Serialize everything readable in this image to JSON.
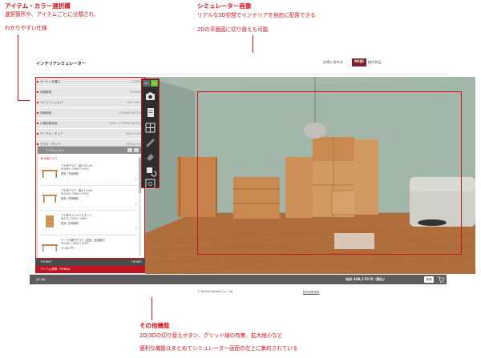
{
  "annotations": {
    "item_select": {
      "title": "アイテム・カラー選択欄",
      "lines": [
        "選択箇所や、アイテムごとに分類され、",
        "わかりやすい仕様"
      ]
    },
    "simulator": {
      "title": "シミュレーター画像",
      "lines": [
        "リアルな3D空間でインテリアを自由に配置できる",
        "2Dの平面図に切り替えも可能"
      ]
    },
    "other": {
      "title": "その他機能",
      "lines": [
        "2D/3Dの切り替えボタン、グリッド線の有無、拡大縮小など",
        "便利な機能はまとめてシミュレーター画面の左上に集約されている"
      ]
    }
  },
  "app": {
    "title": "インテリアシミュレーター",
    "contact": "お問い合わせ",
    "brand_logo": "MUJI",
    "brand_text": "無印良品"
  },
  "sidebar": {
    "categories": [
      {
        "label": "カーテンを選ぶ",
        "sub": "CURTAIN"
      },
      {
        "label": "収納家具",
        "sub": "STORAGE"
      },
      {
        "label": "ユニットシェルフ",
        "sub": "UNIT SHELF"
      },
      {
        "label": "収納用品",
        "sub": "STORING ARTICLE"
      },
      {
        "label": "小物収納用品",
        "sub": "SMALL STORAGE ARTICLE"
      },
      {
        "label": "テーブル・チェア",
        "sub": "TABLE/CHAIR"
      },
      {
        "label": "デスク・チェア",
        "sub": "DESK/CHAIR"
      }
    ],
    "item_panel": {
      "header": "アイテムリスト",
      "sub": "▼ 木製デスク",
      "items": [
        {
          "name": "ブナ材デスク・幅1 6 0 cm",
          "size": "W1600 / D600 / H700",
          "status": "配置 / 配置解除"
        },
        {
          "name": "ブナ材デスク・幅1 2 0 cm",
          "size": "W1200 / D600 / H700",
          "status": "配置 / 配置解除"
        },
        {
          "name": "ブナ材サイドキャビネット",
          "size": "W470 / D520 / H665",
          "status": "配置 / 配置解除"
        },
        {
          "name": "テーブル脚付デスク（旧品・全品番付）",
          "size": "W1180 / D600 / H700",
          "status": "27,800 円〜"
        }
      ]
    },
    "thonet": {
      "label": "THONET",
      "sub": "THONET"
    },
    "redbar": "アイテム参照 / MYBOX"
  },
  "toolbar": {
    "toggle_2d": "2D",
    "toggle_3d": "3D"
  },
  "status": {
    "records": "全18点",
    "total": "合計 438,170 円（税込）",
    "detail": "詳細"
  },
  "footer": {
    "copyright": "© Ryohin Keikaku Co., Ltd.",
    "link": "動作推奨環境"
  },
  "colors": {
    "accent": "#d0141c",
    "wall": "#9db2a5",
    "floor": "#b06e3c",
    "toolbar": "#2d2d2d"
  }
}
